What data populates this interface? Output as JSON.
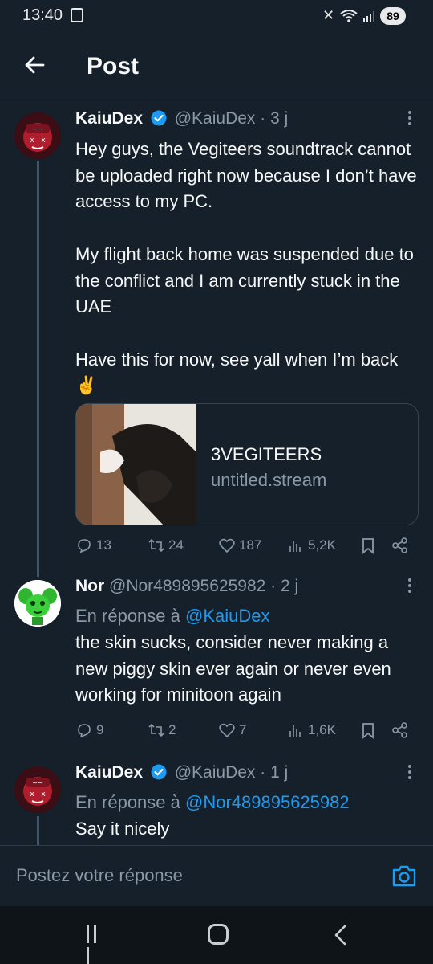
{
  "status_bar": {
    "time": "13:40",
    "battery": "89"
  },
  "header": {
    "title": "Post"
  },
  "tweets": [
    {
      "name": "KaiuDex",
      "handle": "@KaiuDex",
      "time": "· 3 j",
      "body": "Hey guys, the Vegiteers soundtrack cannot be uploaded right now because I don’t have access to my PC.\n\nMy flight back home was suspended due to the conflict and I am currently stuck in the UAE\n\nHave this for now, see yall when I’m back ✌️",
      "card": {
        "title": "3VEGITEERS",
        "subtitle": "untitled.stream"
      },
      "actions": {
        "replies": "13",
        "reposts": "24",
        "likes": "187",
        "views": "5,2K"
      }
    },
    {
      "name": "Nor",
      "handle": "@Nor489895625982",
      "time": "· 2 j",
      "reply_prefix": "En réponse à",
      "reply_to": "@KaiuDex",
      "body": "the skin sucks, consider never making a new piggy skin ever again or never even working for minitoon again",
      "actions": {
        "replies": "9",
        "reposts": "2",
        "likes": "7",
        "views": "1,6K"
      }
    },
    {
      "name": "KaiuDex",
      "handle": "@KaiuDex",
      "time": "· 1 j",
      "reply_prefix": "En réponse à",
      "reply_to": "@Nor489895625982",
      "body": "Say it nicely"
    }
  ],
  "compose": {
    "placeholder": "Postez votre réponse"
  },
  "colors": {
    "background": "#15202b",
    "accent": "#1d9bf0",
    "muted": "#8b98a5"
  }
}
